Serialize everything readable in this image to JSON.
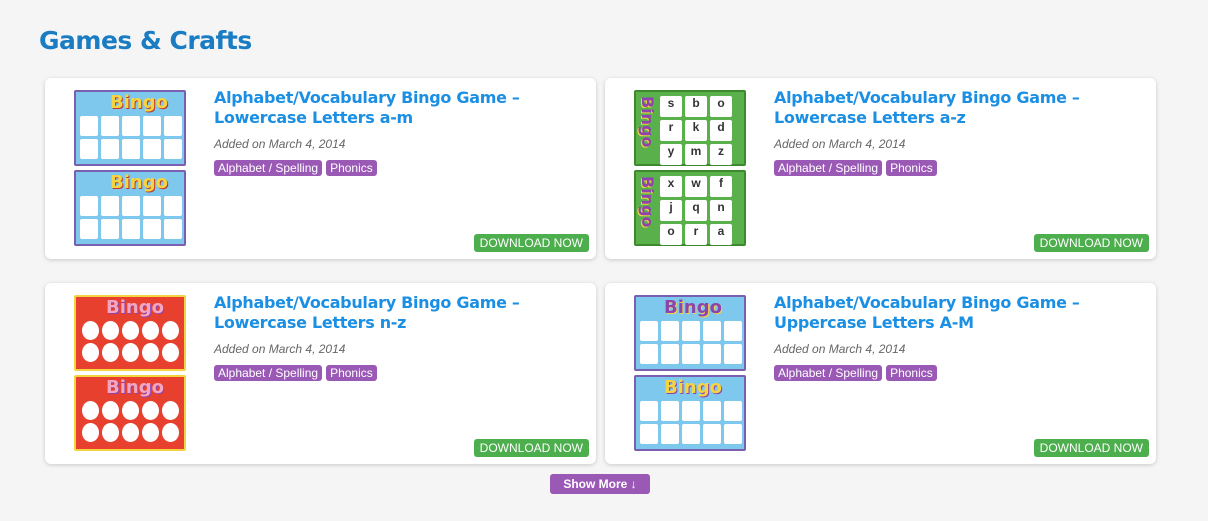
{
  "section": {
    "title": "Games & Crafts"
  },
  "cards": [
    {
      "title": "Alphabet/Vocabulary Bingo Game – Lowercase Letters a-m",
      "date": "Added on March 4, 2014",
      "tags": [
        "Alphabet / Spelling",
        "Phonics"
      ],
      "download": "DOWNLOAD NOW",
      "thumb_style": "blue"
    },
    {
      "title": "Alphabet/Vocabulary Bingo Game – Lowercase Letters a-z",
      "date": "Added on March 4, 2014",
      "tags": [
        "Alphabet / Spelling",
        "Phonics"
      ],
      "download": "DOWNLOAD NOW",
      "thumb_style": "green"
    },
    {
      "title": "Alphabet/Vocabulary Bingo Game – Lowercase Letters n-z",
      "date": "Added on March 4, 2014",
      "tags": [
        "Alphabet / Spelling",
        "Phonics"
      ],
      "download": "DOWNLOAD NOW",
      "thumb_style": "red"
    },
    {
      "title": "Alphabet/Vocabulary Bingo Game – Uppercase Letters A-M",
      "date": "Added on March 4, 2014",
      "tags": [
        "Alphabet / Spelling",
        "Phonics"
      ],
      "download": "DOWNLOAD NOW",
      "thumb_style": "blue"
    }
  ],
  "thumbs": {
    "logo_text": "Bingo",
    "green_letters_top": [
      "s",
      "b",
      "o",
      "r",
      "k",
      "d",
      "y",
      "m",
      "z"
    ],
    "green_letters_bottom": [
      "x",
      "w",
      "f",
      "j",
      "q",
      "n",
      "o",
      "r",
      "a"
    ]
  },
  "show_more": "Show More ↓",
  "colors": {
    "title": "#1a8fe3",
    "heading": "#1a7cc2",
    "tag": "#9b59b6",
    "download": "#4cae4c"
  }
}
